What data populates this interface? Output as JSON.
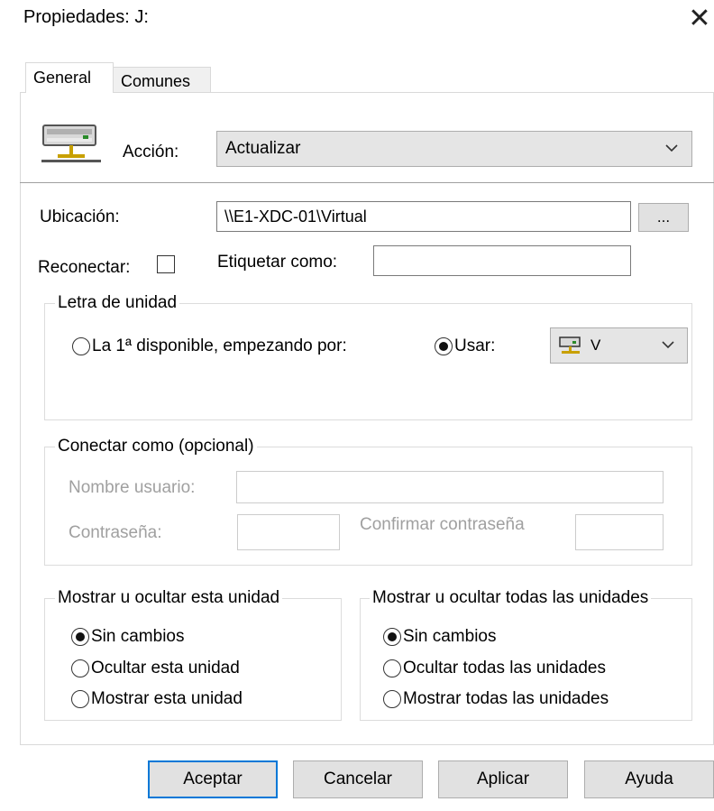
{
  "window": {
    "title": "Propiedades: J:",
    "close_label": "✕"
  },
  "tabs": [
    {
      "label": "General"
    },
    {
      "label": "Comunes"
    }
  ],
  "general": {
    "accion_label": "Acción:",
    "accion_value": "Actualizar",
    "ubicacion_label": "Ubicación:",
    "ubicacion_value": "\\\\E1-XDC-01\\Virtual",
    "browse_label": "...",
    "reconectar_label": "Reconectar:",
    "etiquetar_label": "Etiquetar como:",
    "etiquetar_value": ""
  },
  "letra": {
    "legend": "Letra de unidad",
    "first_available_label": "La 1ª disponible, empezando por:",
    "usar_label": "Usar:",
    "drive_value": "V",
    "selected": "usar"
  },
  "conectar": {
    "legend": "Conectar como (opcional)",
    "usuario_label": "Nombre usuario:",
    "password_label": "Contraseña:",
    "confirm_label": "Confirmar contraseña"
  },
  "mostrar_unidad": {
    "legend": "Mostrar u ocultar esta unidad",
    "options": [
      "Sin cambios",
      "Ocultar esta unidad",
      "Mostrar esta unidad"
    ],
    "selected_index": 0
  },
  "mostrar_todas": {
    "legend": "Mostrar u ocultar todas las unidades",
    "options": [
      "Sin cambios",
      "Ocultar todas las unidades",
      "Mostrar todas las unidades"
    ],
    "selected_index": 0
  },
  "buttons": {
    "aceptar": "Aceptar",
    "cancelar": "Cancelar",
    "aplicar": "Aplicar",
    "ayuda": "Ayuda"
  },
  "colors": {
    "default_button_border": "#0078d7",
    "disabled_text": "#a0a0a0"
  }
}
